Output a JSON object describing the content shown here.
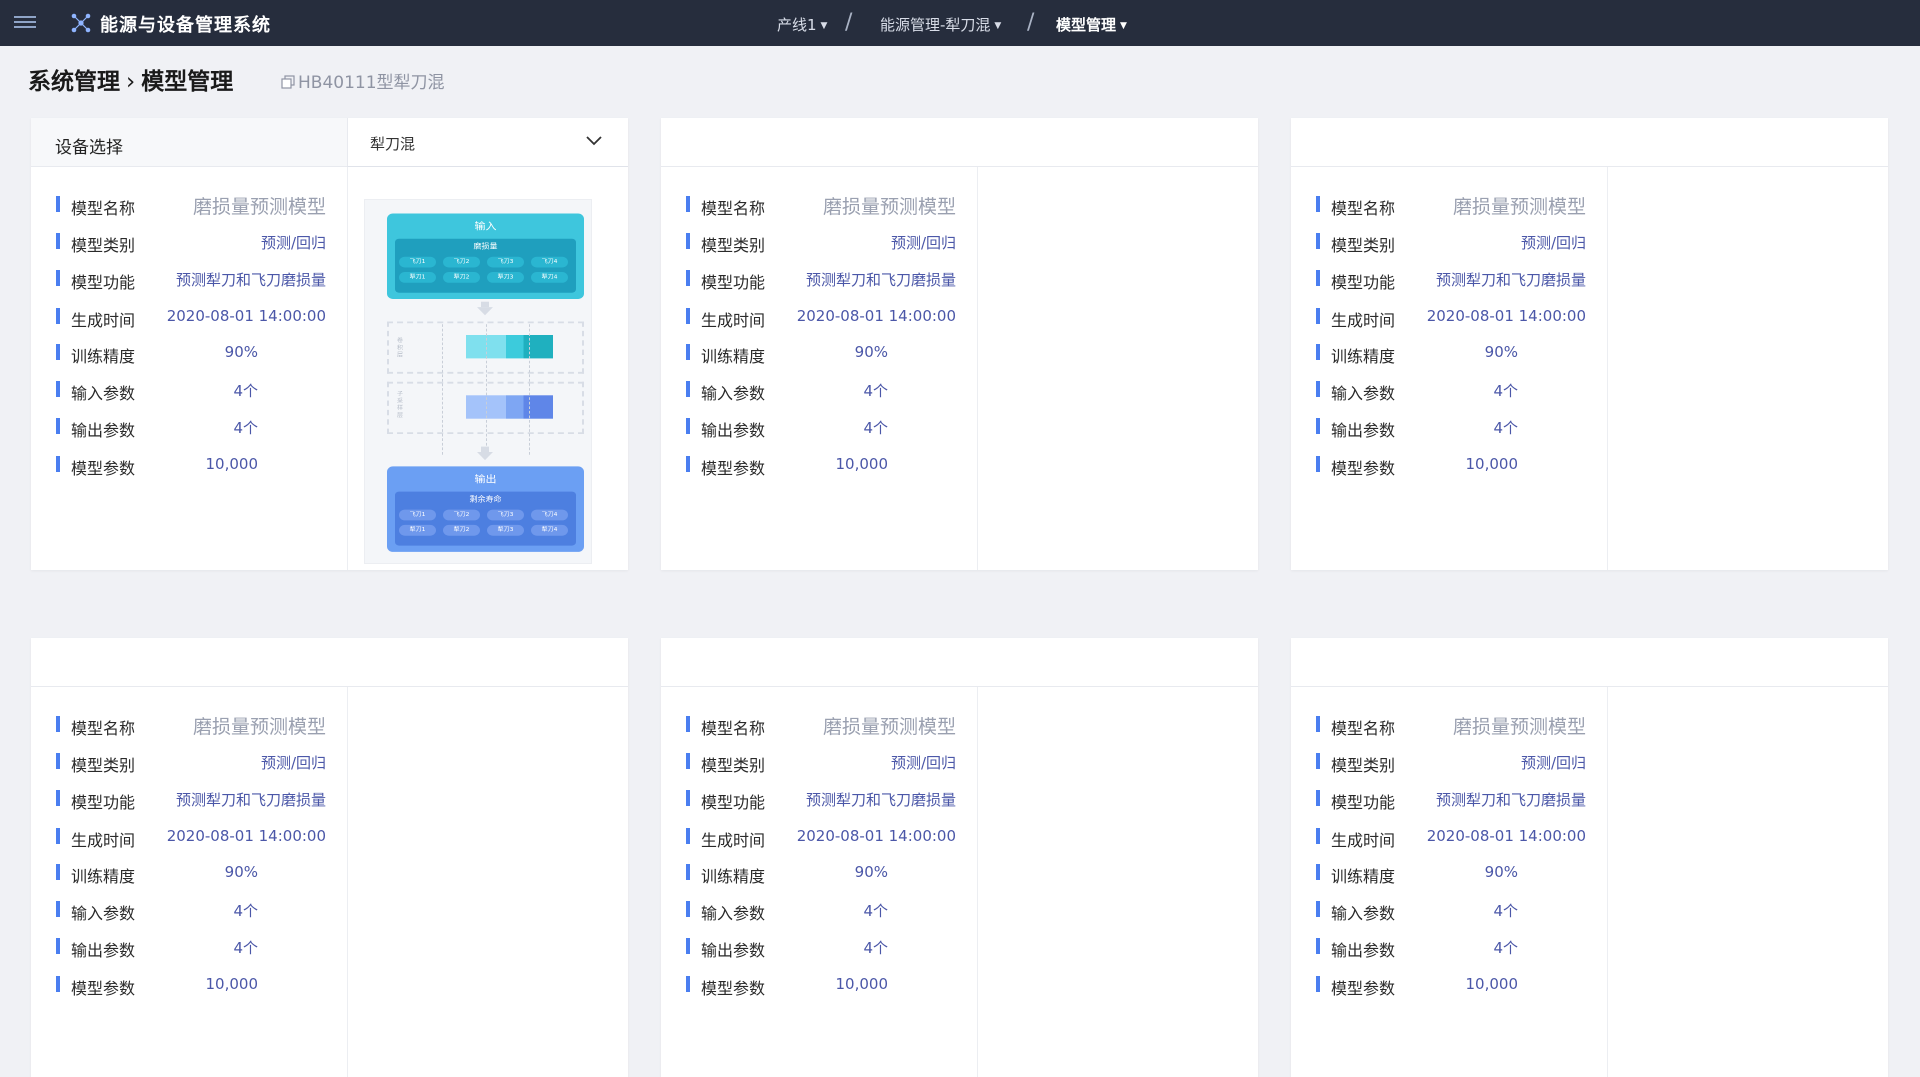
{
  "header": {
    "app_title": "能源与设备管理系统",
    "breadcrumbs": [
      {
        "label": "产线1"
      },
      {
        "label": "能源管理-犁刀混"
      },
      {
        "label": "模型管理"
      }
    ]
  },
  "page": {
    "title_root": "系统管理",
    "title_current": "模型管理",
    "subtitle": "HB40111型犁刀混"
  },
  "device_select": {
    "label": "设备选择",
    "value": "犁刀混"
  },
  "field_labels": {
    "name": "模型名称",
    "category": "模型类别",
    "function": "模型功能",
    "created": "生成时间",
    "accuracy": "训练精度",
    "inputs": "输入参数",
    "outputs": "输出参数",
    "params": "模型参数"
  },
  "models": [
    {
      "name": "磨损量预测模型",
      "category": "预测/回归",
      "function": "预测犁刀和飞刀磨损量",
      "created": "2020-08-01 14:00:00",
      "accuracy": "90%",
      "inputs": "4个",
      "outputs": "4个",
      "params": "10,000"
    },
    {
      "name": "磨损量预测模型",
      "category": "预测/回归",
      "function": "预测犁刀和飞刀磨损量",
      "created": "2020-08-01 14:00:00",
      "accuracy": "90%",
      "inputs": "4个",
      "outputs": "4个",
      "params": "10,000"
    },
    {
      "name": "磨损量预测模型",
      "category": "预测/回归",
      "function": "预测犁刀和飞刀磨损量",
      "created": "2020-08-01 14:00:00",
      "accuracy": "90%",
      "inputs": "4个",
      "outputs": "4个",
      "params": "10,000"
    },
    {
      "name": "磨损量预测模型",
      "category": "预测/回归",
      "function": "预测犁刀和飞刀磨损量",
      "created": "2020-08-01 14:00:00",
      "accuracy": "90%",
      "inputs": "4个",
      "outputs": "4个",
      "params": "10,000"
    },
    {
      "name": "磨损量预测模型",
      "category": "预测/回归",
      "function": "预测犁刀和飞刀磨损量",
      "created": "2020-08-01 14:00:00",
      "accuracy": "90%",
      "inputs": "4个",
      "outputs": "4个",
      "params": "10,000"
    },
    {
      "name": "磨损量预测模型",
      "category": "预测/回归",
      "function": "预测犁刀和飞刀磨损量",
      "created": "2020-08-01 14:00:00",
      "accuracy": "90%",
      "inputs": "4个",
      "outputs": "4个",
      "params": "10,000"
    }
  ],
  "diagram": {
    "input_title": "输入",
    "input_group": "磨损量",
    "input_chips": [
      "飞刀1",
      "飞刀2",
      "飞刀3",
      "飞刀4",
      "犁刀1",
      "犁刀2",
      "犁刀3",
      "犁刀4"
    ],
    "layer1_label": "卷积层",
    "layer2_label": "子采样层",
    "output_title": "输出",
    "output_group": "剩余寿命",
    "output_chips": [
      "飞刀1",
      "飞刀2",
      "飞刀3",
      "飞刀4",
      "犁刀1",
      "犁刀2",
      "犁刀3",
      "犁刀4"
    ]
  },
  "colors": {
    "topbar": "#262d3d",
    "accent_bar": "#4a7ef0",
    "value_text": "#4b57a8",
    "input_block": "#3ec6dd",
    "output_block": "#6b9ff3"
  }
}
